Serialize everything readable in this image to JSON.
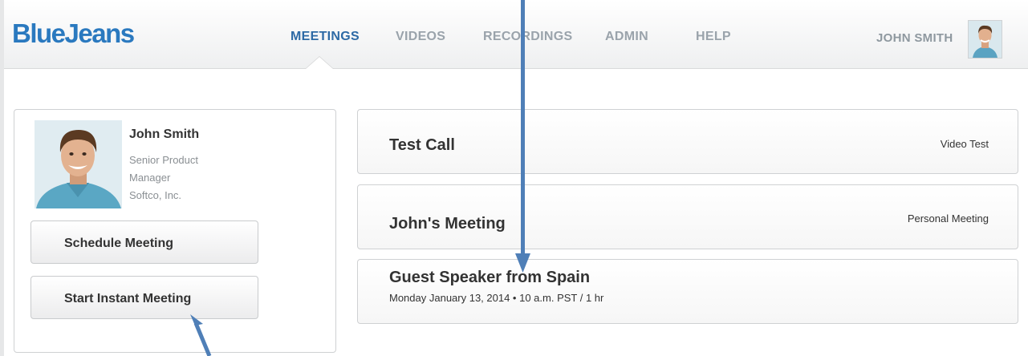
{
  "brand": {
    "logo_text": "BlueJeans",
    "logo_color": "#2a79bf"
  },
  "nav": {
    "items": [
      {
        "label": "MEETINGS",
        "active": true
      },
      {
        "label": "VIDEOS",
        "active": false
      },
      {
        "label": "RECORDINGS",
        "active": false
      },
      {
        "label": "ADMIN",
        "active": false
      },
      {
        "label": "HELP",
        "active": false
      }
    ]
  },
  "user": {
    "display_name": "JOHN SMITH",
    "avatar_icon": "person-avatar-icon"
  },
  "profile": {
    "name": "John Smith",
    "title_line1": "Senior Product",
    "title_line2": "Manager",
    "company": "Softco, Inc.",
    "schedule_label": "Schedule Meeting",
    "instant_label": "Start Instant Meeting"
  },
  "meetings": [
    {
      "title": "Test Call",
      "type": "Video Test",
      "details": ""
    },
    {
      "title": "John's Meeting",
      "type": "Personal Meeting",
      "details": ""
    },
    {
      "title": "Guest Speaker from Spain",
      "type": "",
      "details": "Monday January 13, 2014 • 10 a.m. PST / 1 hr"
    }
  ],
  "colors": {
    "accent": "#2d6aa5",
    "nav_inactive": "#9aa3ab",
    "annotation_arrow": "#4f7fb7"
  }
}
